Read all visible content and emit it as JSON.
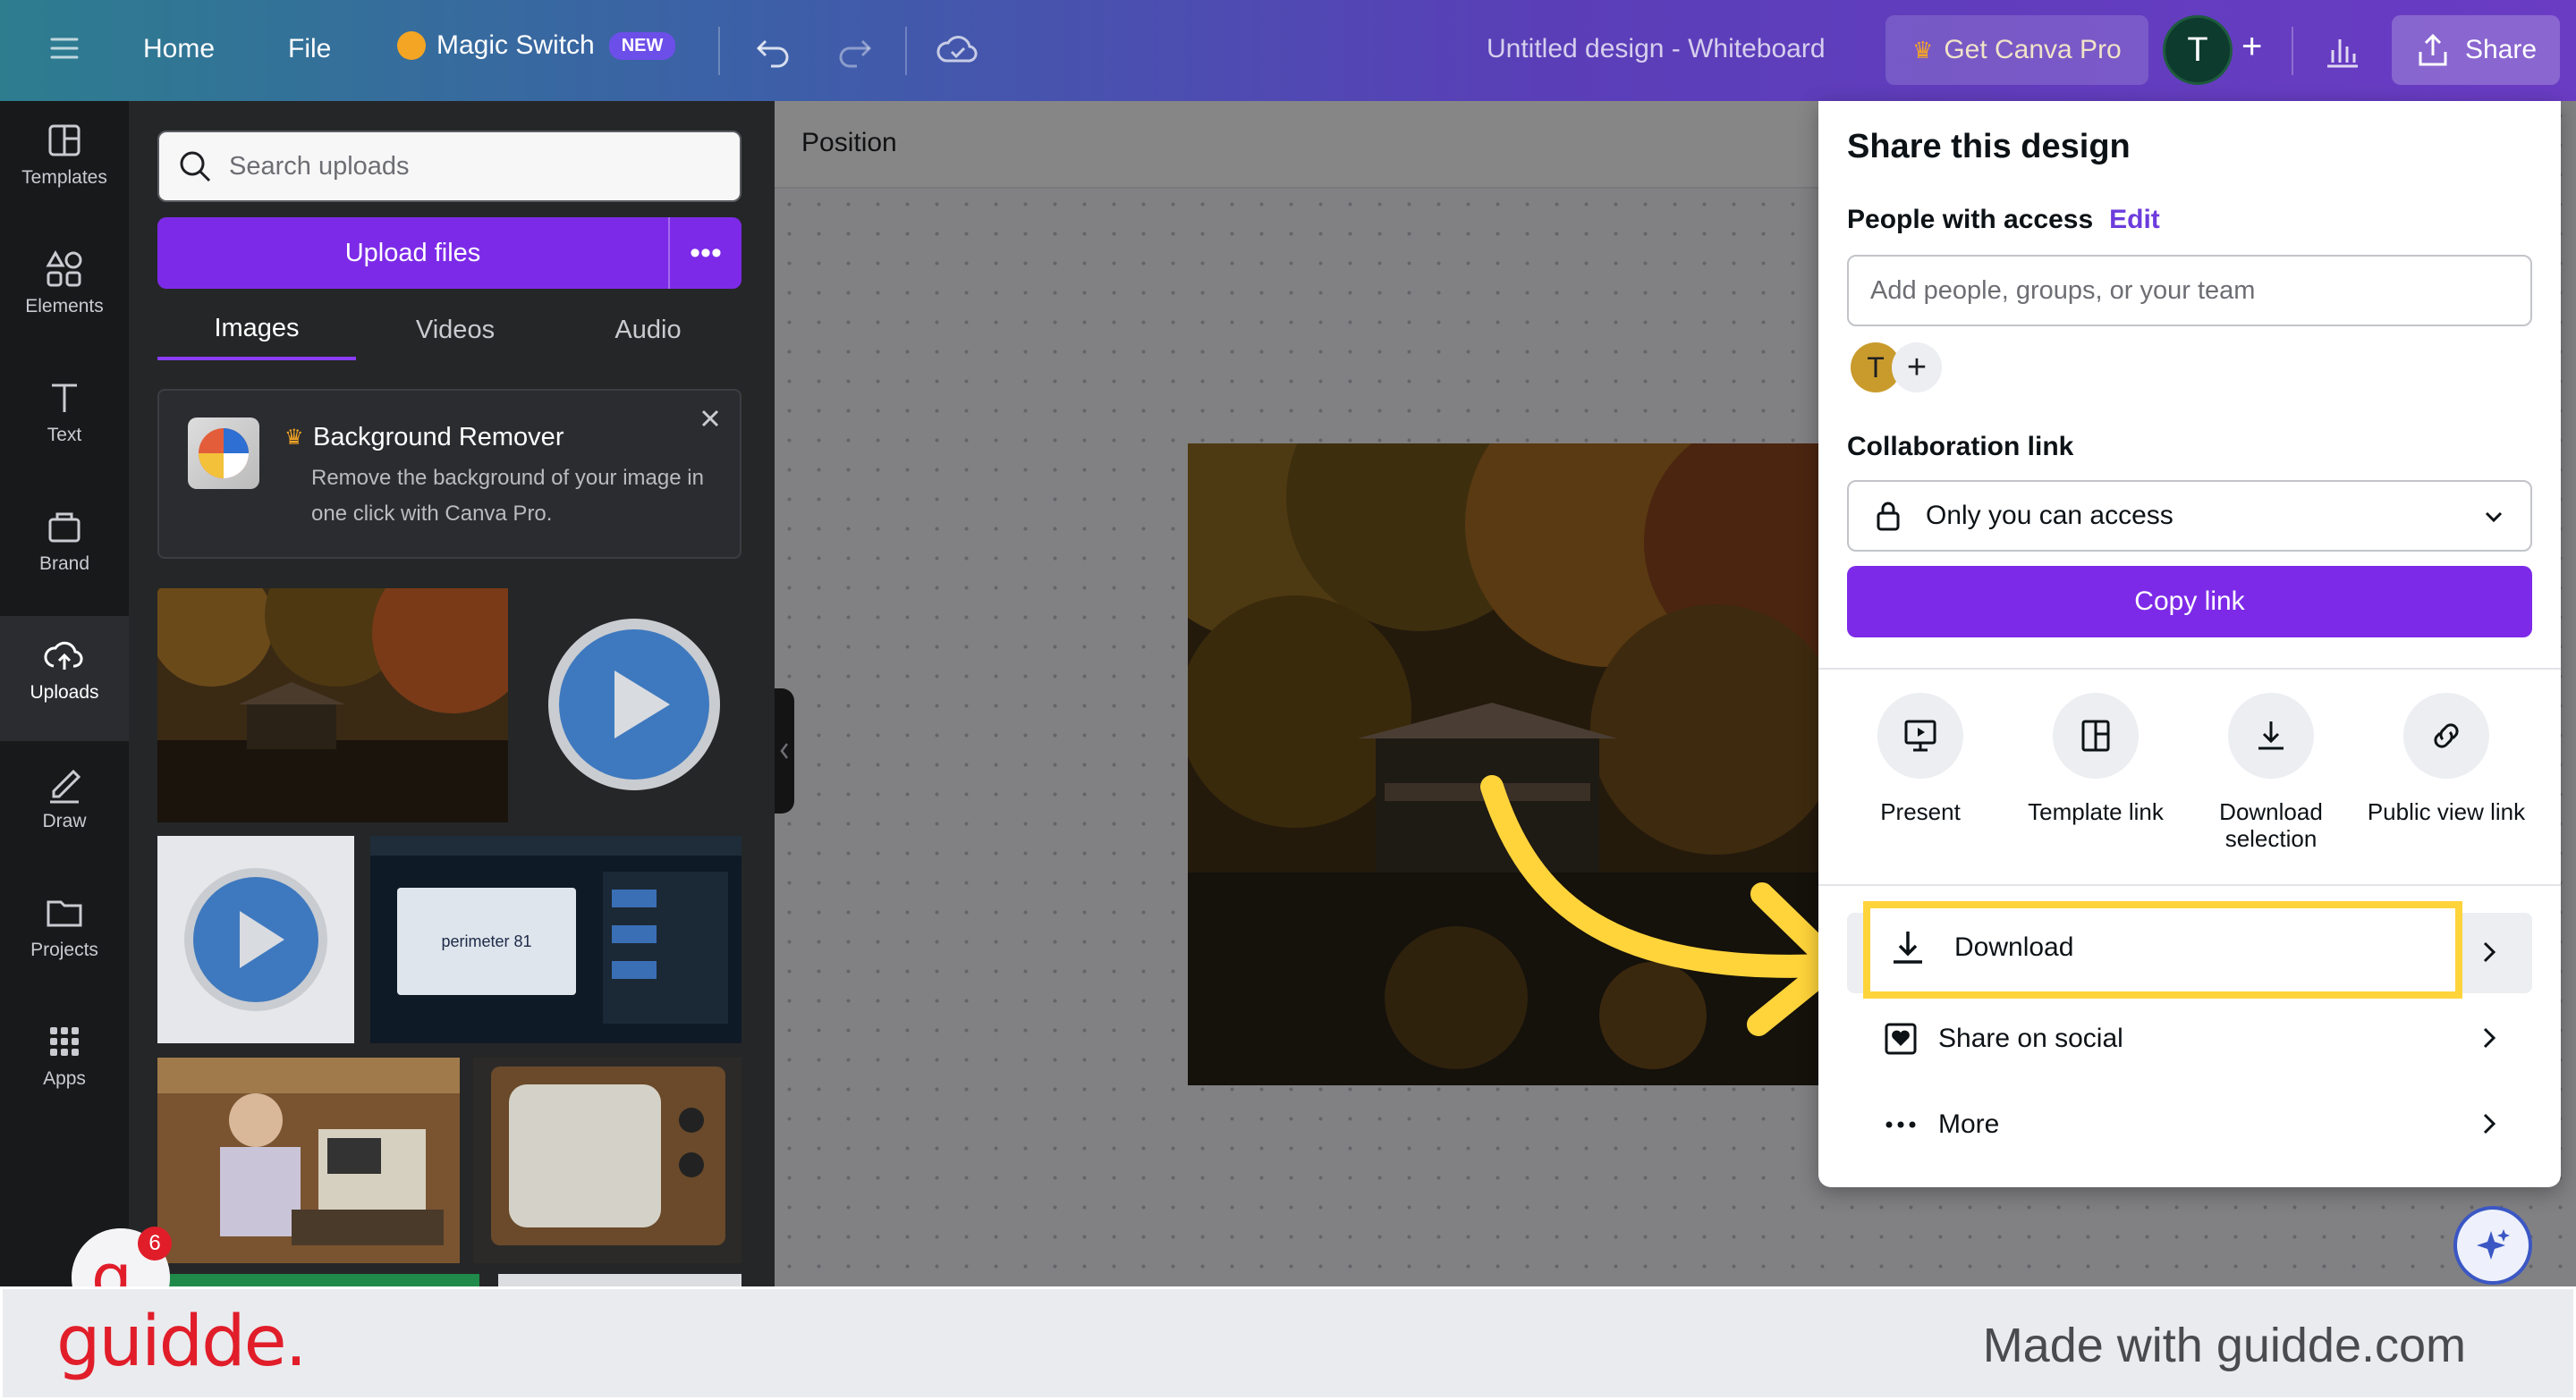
{
  "topbar": {
    "home": "Home",
    "file": "File",
    "magic_switch": "Magic Switch",
    "new_badge": "NEW",
    "title": "Untitled design - Whiteboard",
    "get_pro": "Get Canva Pro",
    "avatar_letter": "T",
    "share": "Share"
  },
  "rail": {
    "items": [
      {
        "label": "Templates",
        "icon": "templates-icon"
      },
      {
        "label": "Elements",
        "icon": "elements-icon"
      },
      {
        "label": "Text",
        "icon": "text-icon"
      },
      {
        "label": "Brand",
        "icon": "brand-icon"
      },
      {
        "label": "Uploads",
        "icon": "uploads-icon",
        "active": true
      },
      {
        "label": "Draw",
        "icon": "draw-icon"
      },
      {
        "label": "Projects",
        "icon": "projects-icon"
      },
      {
        "label": "Apps",
        "icon": "apps-icon"
      }
    ]
  },
  "panel": {
    "search_placeholder": "Search uploads",
    "upload_files": "Upload files",
    "tabs": [
      {
        "label": "Images",
        "active": true
      },
      {
        "label": "Videos"
      },
      {
        "label": "Audio"
      }
    ],
    "promo": {
      "title": "Background Remover",
      "desc": "Remove the background of your image in one click with Canva Pro."
    },
    "thumb_text": "perimeter 81"
  },
  "canvas": {
    "position_label": "Position"
  },
  "share": {
    "title": "Share this design",
    "people_label": "People with access",
    "edit": "Edit",
    "add_placeholder": "Add people, groups, or your team",
    "member_letter": "T",
    "collab_label": "Collaboration link",
    "access_value": "Only you can access",
    "copy_link": "Copy link",
    "options": [
      {
        "label": "Present",
        "icon": "present-icon"
      },
      {
        "label": "Template link",
        "icon": "template-link-icon"
      },
      {
        "label": "Download selection",
        "icon": "download-selection-icon"
      },
      {
        "label": "Public view link",
        "icon": "public-view-link-icon"
      }
    ],
    "rows": [
      {
        "label": "Download",
        "icon": "download-icon"
      },
      {
        "label": "Share on social",
        "icon": "share-social-icon"
      },
      {
        "label": "More",
        "icon": "more-dots-icon"
      }
    ]
  },
  "guidde": {
    "notification_count": "6",
    "logo": "guidde.",
    "made_with": "Made with guidde.com"
  },
  "colors": {
    "accent_purple": "#7d2ae8",
    "highlight_yellow": "#ffd43b",
    "guidde_red": "#e11d2a"
  }
}
